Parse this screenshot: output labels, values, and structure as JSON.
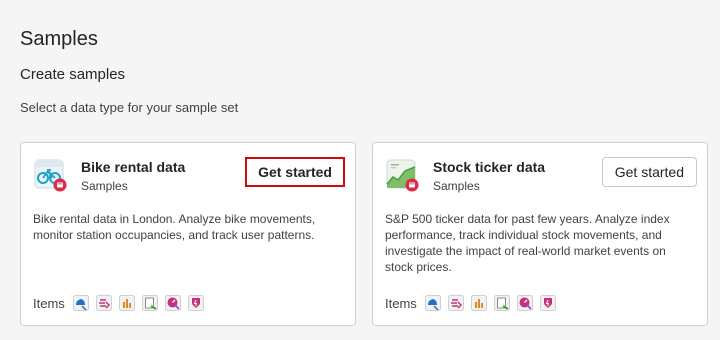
{
  "page": {
    "title": "Samples",
    "section_title": "Create samples",
    "section_subtitle": "Select a data type for your sample set"
  },
  "cards": [
    {
      "name": "Bike rental data",
      "kind": "Samples",
      "button_label": "Get started",
      "description": "Bike rental data in London. Analyze bike movements, monitor station occupancies, and track user patterns.",
      "items_label": "Items",
      "icon": "bike-icon",
      "item_icons": [
        "eventhouse-icon",
        "eventstream-icon",
        "kql-queryset-icon",
        "notebook-icon",
        "real-time-dashboard-icon",
        "activator-icon"
      ]
    },
    {
      "name": "Stock ticker data",
      "kind": "Samples",
      "button_label": "Get started",
      "description": "S&P 500 ticker data for past few years. Analyze index performance, track individual stock movements, and investigate the impact of real-world market events on stock prices.",
      "items_label": "Items",
      "icon": "stock-chart-icon",
      "item_icons": [
        "eventhouse-icon",
        "eventstream-icon",
        "kql-queryset-icon",
        "notebook-icon",
        "real-time-dashboard-icon",
        "activator-icon"
      ]
    }
  ],
  "colors": {
    "highlight": "#d10b0b",
    "accent_pink": "#c4317a",
    "accent_blue": "#1a73c7",
    "accent_green": "#4a9d3e"
  }
}
